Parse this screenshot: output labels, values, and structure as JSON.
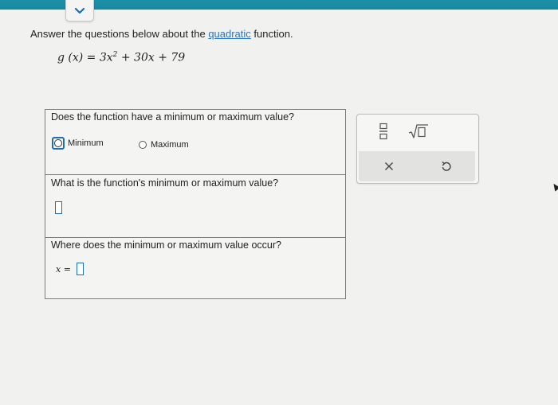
{
  "header": {
    "collapse_icon": "chevron-down-icon"
  },
  "prompt": {
    "before": "Answer the questions below about the ",
    "link": "quadratic",
    "after": " function."
  },
  "equation": {
    "lhs": "g (x) = 3x",
    "exponent": "2",
    "rhs": " + 30x + 79"
  },
  "questions": {
    "q1": {
      "text": "Does the function have a minimum or maximum value?",
      "options": [
        "Minimum",
        "Maximum"
      ],
      "selected": "Minimum"
    },
    "q2": {
      "text": "What is the function's minimum or maximum value?",
      "answer": ""
    },
    "q3": {
      "text": "Where does the minimum or maximum value occur?",
      "var_label": "x =",
      "answer": ""
    }
  },
  "tools": {
    "fraction": "fraction-icon",
    "sqrt": "square-root-icon",
    "clear": "close-icon",
    "undo": "undo-icon"
  },
  "colors": {
    "top_bar": "#1c90a8",
    "accent": "#1d6fb2",
    "link": "#2b74b9"
  }
}
